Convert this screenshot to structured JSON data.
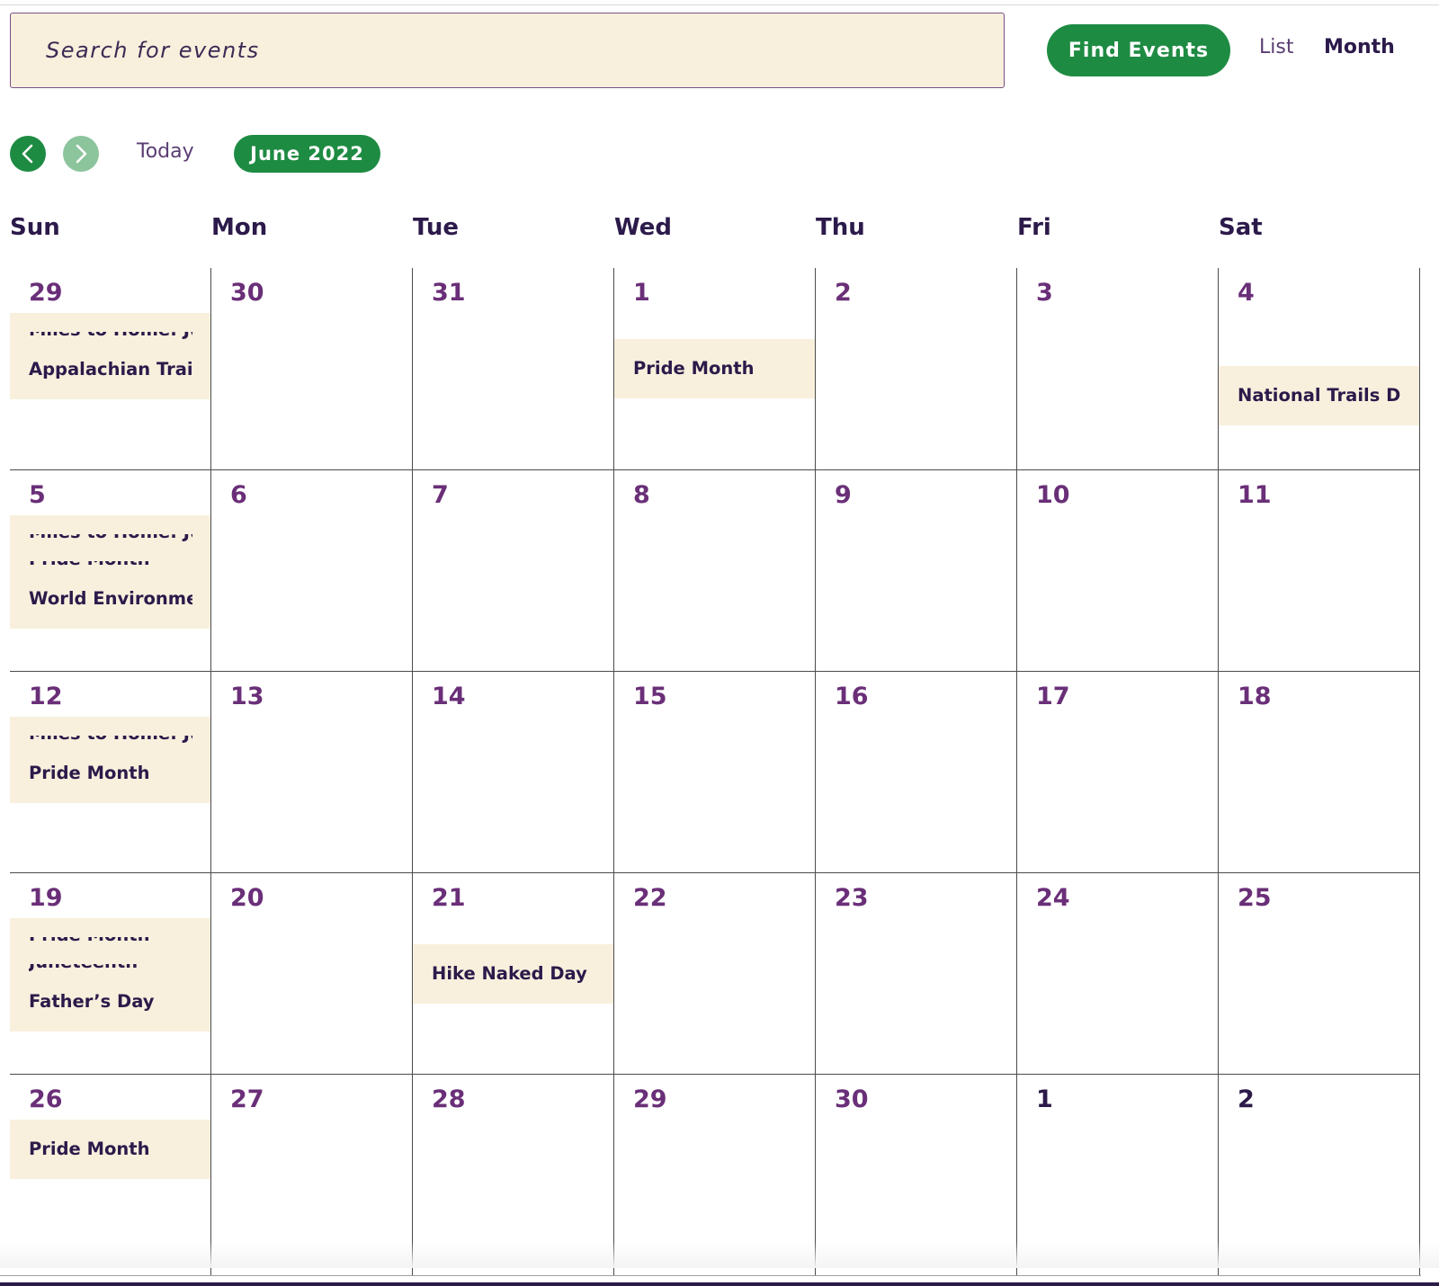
{
  "search": {
    "placeholder": "Search for events"
  },
  "header": {
    "find_label": "Find Events",
    "view_list": "List",
    "view_month": "Month"
  },
  "nav": {
    "today_label": "Today",
    "current_month": "June 2022",
    "prev_icon": "chevron-left-icon",
    "next_icon": "chevron-right-icon"
  },
  "weekdays": [
    "Sun",
    "Mon",
    "Tue",
    "Wed",
    "Thu",
    "Fri",
    "Sat"
  ],
  "weeks": [
    [
      {
        "day": "29",
        "kind": "prev",
        "events": [
          "Miles to Home: Just",
          "Appalachian Trail B"
        ],
        "clipped": [
          true,
          false
        ]
      },
      {
        "day": "30",
        "kind": "prev",
        "events": []
      },
      {
        "day": "31",
        "kind": "prev",
        "events": []
      },
      {
        "day": "1",
        "kind": "cur",
        "events": [
          "Pride Month"
        ]
      },
      {
        "day": "2",
        "kind": "cur",
        "events": []
      },
      {
        "day": "3",
        "kind": "cur",
        "events": []
      },
      {
        "day": "4",
        "kind": "cur",
        "events": [
          "National Trails Da"
        ]
      }
    ],
    [
      {
        "day": "5",
        "kind": "cur",
        "events": [
          "Miles to Home: Just",
          "Pride Month",
          "World Environme"
        ],
        "clipped": [
          true,
          true,
          false
        ]
      },
      {
        "day": "6",
        "kind": "cur",
        "events": []
      },
      {
        "day": "7",
        "kind": "cur",
        "events": []
      },
      {
        "day": "8",
        "kind": "cur",
        "events": []
      },
      {
        "day": "9",
        "kind": "cur",
        "events": []
      },
      {
        "day": "10",
        "kind": "cur",
        "events": []
      },
      {
        "day": "11",
        "kind": "cur",
        "events": []
      }
    ],
    [
      {
        "day": "12",
        "kind": "cur",
        "events": [
          "Miles to Home: Just",
          "Pride Month"
        ],
        "clipped": [
          true,
          false
        ]
      },
      {
        "day": "13",
        "kind": "cur",
        "events": []
      },
      {
        "day": "14",
        "kind": "cur",
        "events": []
      },
      {
        "day": "15",
        "kind": "cur",
        "events": []
      },
      {
        "day": "16",
        "kind": "cur",
        "events": []
      },
      {
        "day": "17",
        "kind": "cur",
        "events": []
      },
      {
        "day": "18",
        "kind": "cur",
        "events": []
      }
    ],
    [
      {
        "day": "19",
        "kind": "cur",
        "events": [
          "Pride Month",
          "Juneteenth",
          "Father’s Day"
        ],
        "clipped": [
          true,
          true,
          false
        ]
      },
      {
        "day": "20",
        "kind": "cur",
        "events": []
      },
      {
        "day": "21",
        "kind": "cur",
        "events": [
          "Hike Naked Day"
        ]
      },
      {
        "day": "22",
        "kind": "cur",
        "events": []
      },
      {
        "day": "23",
        "kind": "cur",
        "events": []
      },
      {
        "day": "24",
        "kind": "cur",
        "events": []
      },
      {
        "day": "25",
        "kind": "cur",
        "events": []
      }
    ],
    [
      {
        "day": "26",
        "kind": "cur",
        "events": [
          "Pride Month"
        ]
      },
      {
        "day": "27",
        "kind": "cur",
        "events": []
      },
      {
        "day": "28",
        "kind": "cur",
        "events": []
      },
      {
        "day": "29",
        "kind": "cur",
        "events": []
      },
      {
        "day": "30",
        "kind": "cur",
        "events": []
      },
      {
        "day": "1",
        "kind": "next",
        "events": []
      },
      {
        "day": "2",
        "kind": "next",
        "events": []
      }
    ]
  ],
  "colors": {
    "accent_green": "#1e8b43",
    "event_bg": "#f8f0dd",
    "day_purple": "#6a2f78",
    "text_dark": "#2b1a4a"
  }
}
